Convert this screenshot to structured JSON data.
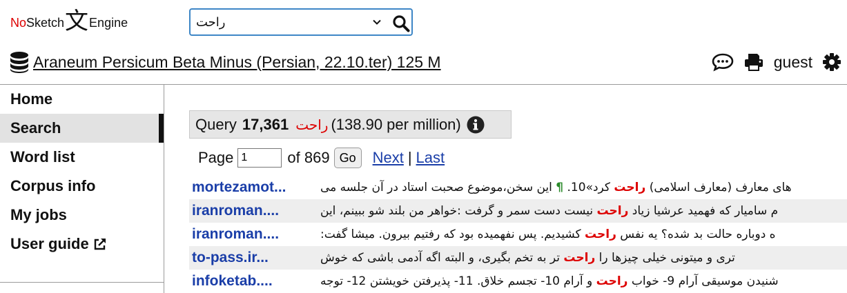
{
  "logo": {
    "part1": "No",
    "part2": "Sketch",
    "glyph": "文",
    "part3": "Engine"
  },
  "search": {
    "value": "راحت"
  },
  "corpus": {
    "name": "Araneum Persicum Beta Minus (Persian, 22.10.ter) 125 M"
  },
  "user": {
    "name": "guest"
  },
  "sidebar": {
    "items": [
      {
        "label": "Home",
        "active": false
      },
      {
        "label": "Search",
        "active": true
      },
      {
        "label": "Word list",
        "active": false
      },
      {
        "label": "Corpus info",
        "active": false
      },
      {
        "label": "My jobs",
        "active": false
      },
      {
        "label": "User guide",
        "active": false
      }
    ]
  },
  "query": {
    "label": "Query",
    "count": "17,361",
    "keyword": "راحت",
    "per_million": "(138.90 per million)"
  },
  "pager": {
    "page_label": "Page",
    "page_value": "1",
    "of_label": "of 869",
    "go_label": "Go",
    "next_label": "Next",
    "sep": "|",
    "last_label": "Last"
  },
  "results": [
    {
      "source": "mortezamot...",
      "left": "های معارف (معارف اسلامی) ",
      "kw": "راحت",
      "right": " کرد»10. ",
      "extra": " این سخن،موضوع صحبت استاد در آن جلسه می",
      "mark": "¶"
    },
    {
      "source": "iranroman....",
      "left": "م سامیار که فهمید عرشیا زیاد ",
      "kw": "راحت",
      "right": " نیست دست سمر و گرفت :خواهر من بلند شو ببینم، این",
      "extra": "",
      "mark": ""
    },
    {
      "source": "iranroman....",
      "left": "ه دوباره حالت بد شده؟ یه نفس ",
      "kw": "راحت",
      "right": " کشیدیم. پس نفهمیده بود که رفتیم بیرون. میشا گفت:",
      "extra": "",
      "mark": ""
    },
    {
      "source": "to-pass.ir...",
      "left": "تری و میتونی خیلی چیزها را ",
      "kw": "راحت",
      "right": " تر به تخم بگیری، و البته اگه آدمی باشی که خوش",
      "extra": "",
      "mark": ""
    },
    {
      "source": "infoketab....",
      "left": "شنیدن موسیقی آرام 9- خواب ",
      "kw": "راحت",
      "right": " و آرام 10- تجسم خلاق. 11- پذیرفتن خویشتن 12- توجه",
      "extra": "",
      "mark": ""
    }
  ]
}
